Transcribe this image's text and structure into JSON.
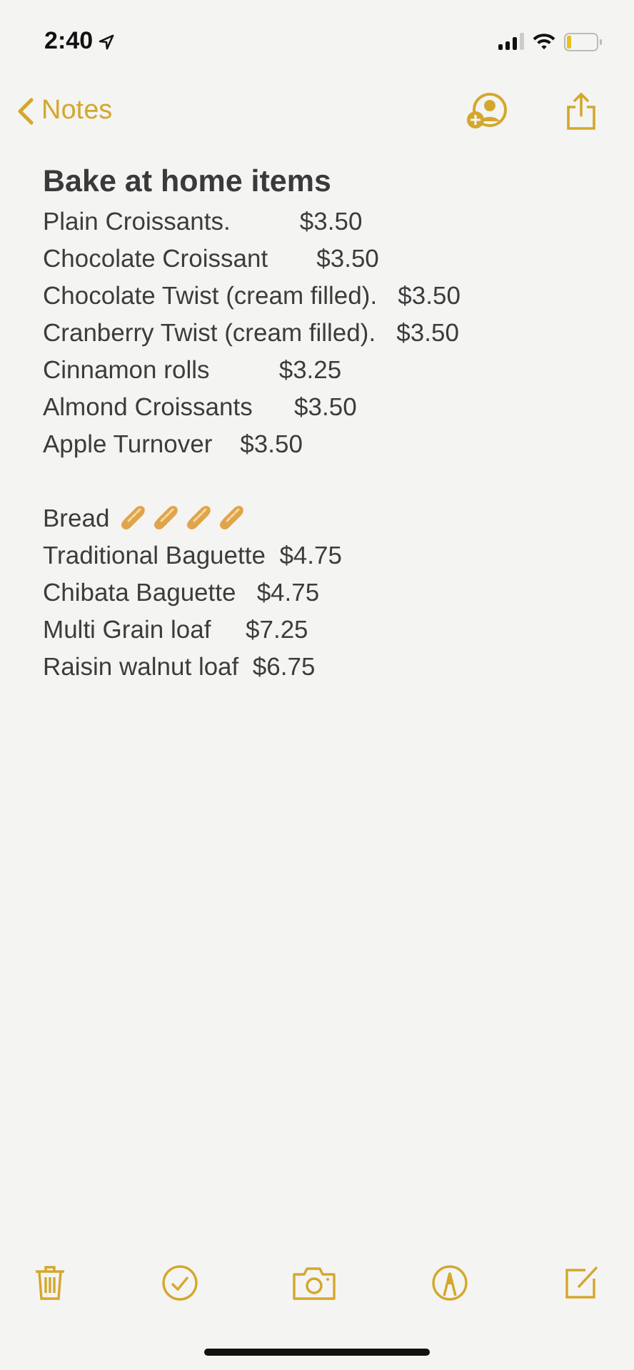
{
  "status_bar": {
    "time": "2:40"
  },
  "nav": {
    "back_label": "Notes"
  },
  "note": {
    "title": "Bake at home items",
    "lines": [
      {
        "kind": "text",
        "text": "Plain Croissants.          $3.50"
      },
      {
        "kind": "text",
        "text": "Chocolate Croissant       $3.50"
      },
      {
        "kind": "text",
        "text": "Chocolate Twist (cream filled).   $3.50"
      },
      {
        "kind": "text",
        "text": "Cranberry Twist (cream filled).   $3.50"
      },
      {
        "kind": "text",
        "text": "Cinnamon rolls          $3.25"
      },
      {
        "kind": "text",
        "text": "Almond Croissants      $3.50"
      },
      {
        "kind": "text",
        "text": "Apple Turnover    $3.50"
      },
      {
        "kind": "blank"
      },
      {
        "kind": "bread",
        "text": "Bread"
      },
      {
        "kind": "text",
        "text": "Traditional Baguette  $4.75"
      },
      {
        "kind": "text",
        "text": "Chibata Baguette   $4.75"
      },
      {
        "kind": "text",
        "text": "Multi Grain loaf     $7.25"
      },
      {
        "kind": "text",
        "text": "Raisin walnut loaf  $6.75"
      }
    ]
  }
}
